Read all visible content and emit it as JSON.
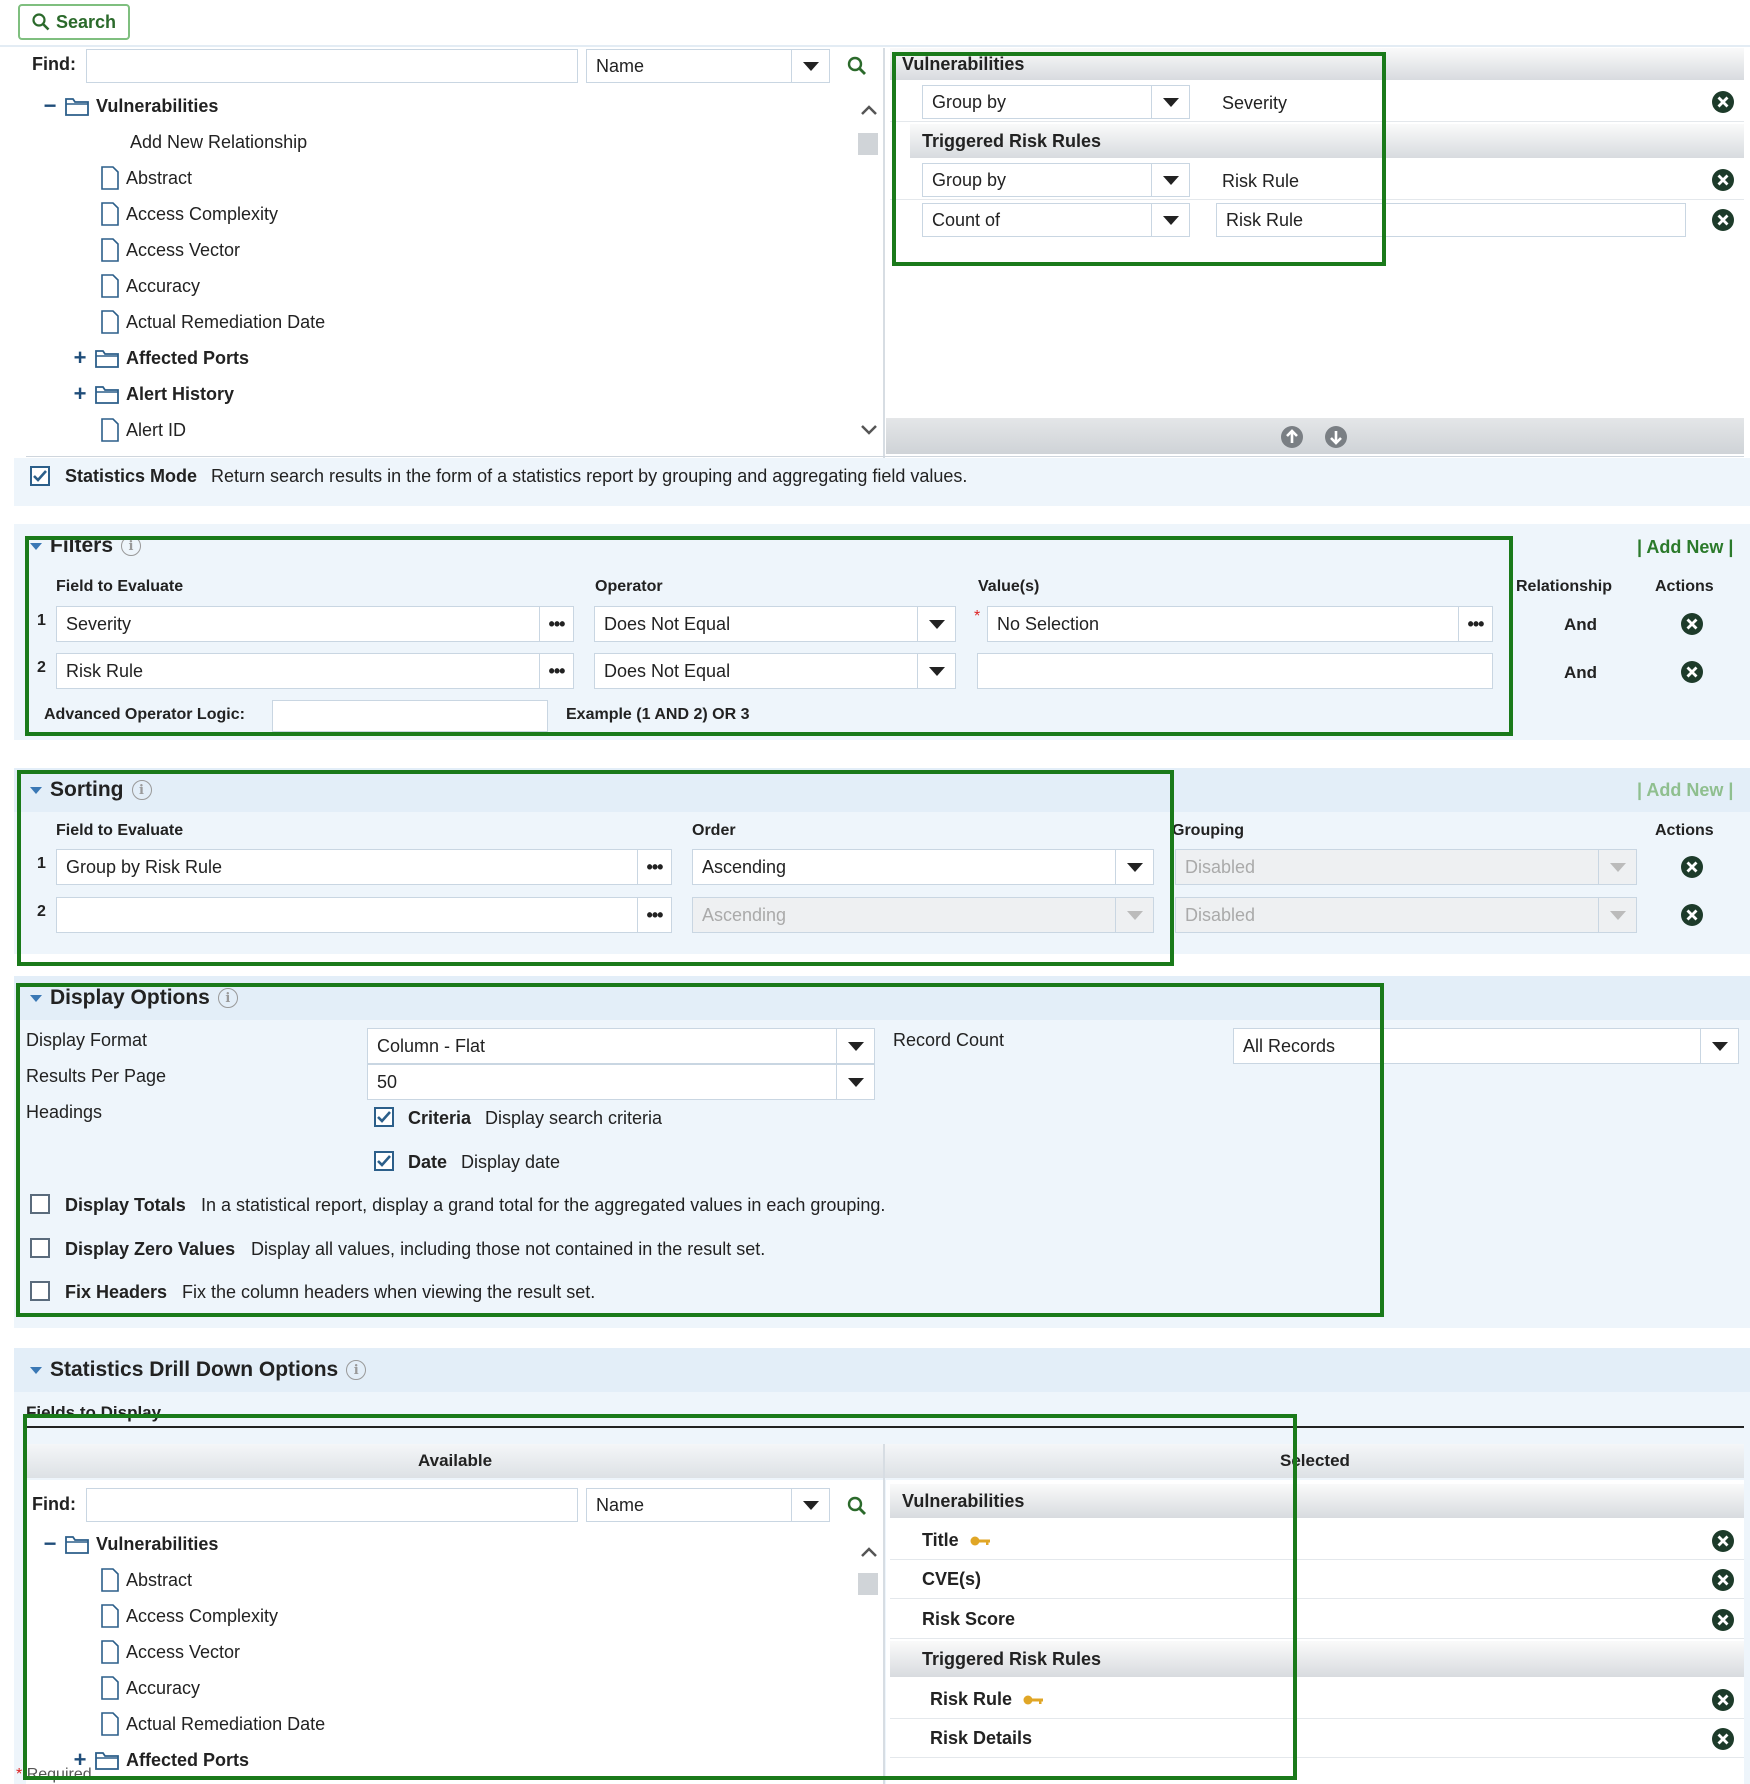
{
  "toolbar": {
    "search_label": "Search"
  },
  "fields_tree": {
    "find_label": "Find:",
    "find_value": "",
    "filter_select": "Name",
    "root": "Vulnerabilities",
    "add_new": "Add New Relationship",
    "items": [
      {
        "label": "Abstract",
        "type": "field"
      },
      {
        "label": "Access Complexity",
        "type": "field"
      },
      {
        "label": "Access Vector",
        "type": "field"
      },
      {
        "label": "Accuracy",
        "type": "field"
      },
      {
        "label": "Actual Remediation Date",
        "type": "field"
      },
      {
        "label": "Affected Ports",
        "type": "folder"
      },
      {
        "label": "Alert History",
        "type": "folder"
      },
      {
        "label": "Alert ID",
        "type": "field"
      }
    ]
  },
  "stats_selected": {
    "group1_title": "Vulnerabilities",
    "rows1": [
      {
        "agg": "Group by",
        "field": "Severity"
      }
    ],
    "group2_title": "Triggered Risk Rules",
    "rows2": [
      {
        "agg": "Group by",
        "field": "Risk Rule"
      },
      {
        "agg": "Count of",
        "field": "Risk Rule"
      }
    ]
  },
  "stats_mode": {
    "label": "Statistics Mode",
    "description": "Return search results in the form of a statistics report by grouping and aggregating field values."
  },
  "filters": {
    "title": "Filters",
    "add_new": "| Add New |",
    "headers": {
      "field": "Field to Evaluate",
      "operator": "Operator",
      "values": "Value(s)",
      "relationship": "Relationship",
      "actions": "Actions"
    },
    "rows": [
      {
        "num": "1",
        "field": "Severity",
        "operator": "Does Not Equal",
        "value": "No Selection",
        "relationship": "And"
      },
      {
        "num": "2",
        "field": "Risk Rule",
        "operator": "Does Not Equal",
        "value": "",
        "relationship": "And"
      }
    ],
    "advanced_label": "Advanced Operator Logic:",
    "advanced_value": "",
    "example": "Example (1 AND 2) OR 3",
    "required_mark": "*"
  },
  "sorting": {
    "title": "Sorting",
    "add_new": "| Add New |",
    "headers": {
      "field": "Field to Evaluate",
      "order": "Order",
      "grouping": "Grouping",
      "actions": "Actions"
    },
    "rows": [
      {
        "num": "1",
        "field": "Group by Risk Rule",
        "order": "Ascending",
        "grouping": "Disabled"
      },
      {
        "num": "2",
        "field": "",
        "order": "Ascending",
        "grouping": "Disabled"
      }
    ]
  },
  "display_options": {
    "title": "Display Options",
    "format_label": "Display Format",
    "format_value": "Column - Flat",
    "per_page_label": "Results Per Page",
    "per_page_value": "50",
    "headings_label": "Headings",
    "record_count_label": "Record Count",
    "record_count_value": "All Records",
    "criteria_label": "Criteria",
    "criteria_desc": "Display search criteria",
    "date_label": "Date",
    "date_desc": "Display date",
    "totals_label": "Display Totals",
    "totals_desc": "In a statistical report, display a grand total for the aggregated values in each grouping.",
    "zero_label": "Display Zero Values",
    "zero_desc": "Display all values, including those not contained in the result set.",
    "fix_label": "Fix Headers",
    "fix_desc": "Fix the column headers when viewing the result set."
  },
  "drilldown": {
    "title": "Statistics Drill Down Options",
    "fields_label": "Fields to Display",
    "available_label": "Available",
    "selected_label": "Selected",
    "find_label": "Find:",
    "filter_select": "Name",
    "root": "Vulnerabilities",
    "items": [
      {
        "label": "Abstract",
        "type": "field"
      },
      {
        "label": "Access Complexity",
        "type": "field"
      },
      {
        "label": "Access Vector",
        "type": "field"
      },
      {
        "label": "Accuracy",
        "type": "field"
      },
      {
        "label": "Actual Remediation Date",
        "type": "field"
      },
      {
        "label": "Affected Ports",
        "type": "folder"
      }
    ],
    "sel_group1": "Vulnerabilities",
    "sel_rows1": [
      "Title",
      "CVE(s)",
      "Risk Score"
    ],
    "sel_group2": "Triggered Risk Rules",
    "sel_rows2": [
      "Risk Rule",
      "Risk Details"
    ],
    "required_text": "Required"
  },
  "colors": {
    "frame": "#1a7a1a",
    "accent": "#2c5f8a",
    "link": "#2b7a2b"
  }
}
